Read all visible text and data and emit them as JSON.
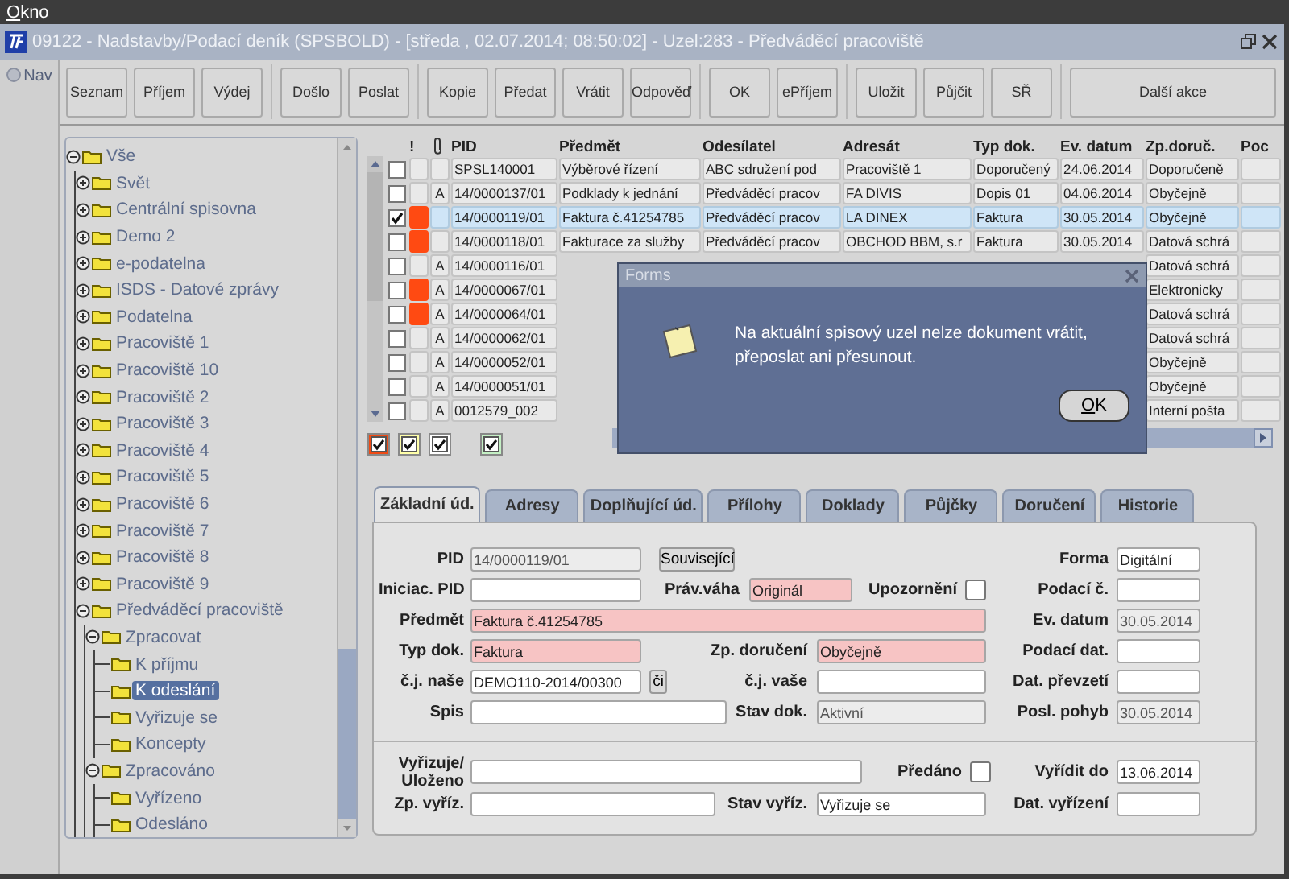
{
  "window": {
    "menu_title": "Okno",
    "title": "09122 - Nadstavby/Podací deník (SPSBOLD) - [středa , 02.07.2014; 08:50:02] - Uzel:283 - Předváděcí pracoviště"
  },
  "nav": {
    "label": "Nav"
  },
  "toolbar": {
    "groups": [
      {
        "buttons": [
          "Seznam",
          "Příjem",
          "Výdej"
        ]
      },
      {
        "buttons": [
          "Došlo",
          "Poslat"
        ]
      },
      {
        "buttons": [
          "Kopie",
          "Předat",
          "Vrátit",
          "Odpověď"
        ]
      },
      {
        "buttons": [
          "OK",
          "ePříjem"
        ]
      },
      {
        "buttons": [
          "Uložit",
          "Půjčit",
          "SŘ"
        ]
      },
      {
        "buttons": [
          "Další akce"
        ]
      }
    ]
  },
  "tree": [
    {
      "label": "Vše",
      "expanded": true,
      "selected": false,
      "children": [
        {
          "label": "Svět",
          "expanded": false,
          "selected": false
        },
        {
          "label": "Centrální spisovna",
          "expanded": false,
          "selected": false
        },
        {
          "label": "Demo 2",
          "expanded": false,
          "selected": false
        },
        {
          "label": "e-podatelna",
          "expanded": false,
          "selected": false
        },
        {
          "label": "ISDS - Datové zprávy",
          "expanded": false,
          "selected": false
        },
        {
          "label": "Podatelna",
          "expanded": false,
          "selected": false
        },
        {
          "label": "Pracoviště 1",
          "expanded": false,
          "selected": false
        },
        {
          "label": "Pracoviště 10",
          "expanded": false,
          "selected": false
        },
        {
          "label": "Pracoviště 2",
          "expanded": false,
          "selected": false
        },
        {
          "label": "Pracoviště 3",
          "expanded": false,
          "selected": false
        },
        {
          "label": "Pracoviště 4",
          "expanded": false,
          "selected": false
        },
        {
          "label": "Pracoviště 5",
          "expanded": false,
          "selected": false
        },
        {
          "label": "Pracoviště 6",
          "expanded": false,
          "selected": false
        },
        {
          "label": "Pracoviště 7",
          "expanded": false,
          "selected": false
        },
        {
          "label": "Pracoviště 8",
          "expanded": false,
          "selected": false
        },
        {
          "label": "Pracoviště 9",
          "expanded": false,
          "selected": false
        },
        {
          "label": "Předváděcí pracoviště",
          "expanded": true,
          "selected": false,
          "children": [
            {
              "label": "Zpracovat",
              "expanded": true,
              "selected": false,
              "children": [
                {
                  "label": "K příjmu",
                  "selected": false
                },
                {
                  "label": "K odeslání",
                  "selected": true
                },
                {
                  "label": "Vyřizuje se",
                  "selected": false
                },
                {
                  "label": "Koncepty",
                  "selected": false
                }
              ]
            },
            {
              "label": "Zpracováno",
              "expanded": true,
              "selected": false,
              "children": [
                {
                  "label": "Vyřízeno",
                  "selected": false
                },
                {
                  "label": "Odesláno",
                  "selected": false
                }
              ]
            }
          ]
        }
      ]
    }
  ],
  "table": {
    "columns": [
      "!",
      "PID",
      "Předmět",
      "Odesílatel",
      "Adresát",
      "Typ dok.",
      "Ev. datum",
      "Zp.doruč.",
      "Poc"
    ],
    "rows": [
      {
        "checked": false,
        "selected": false,
        "pid": "SPSL140001",
        "subject": "Výběrové řízení",
        "sender": "ABC sdružení pod",
        "recipient": "Pracoviště 1",
        "doc_type": "Doporučený",
        "date": "24.06.2014",
        "delivery": "Doporučeně"
      },
      {
        "checked": false,
        "selected": false,
        "mark": "A",
        "pid": "14/0000137/01",
        "subject": "Podklady k jednání",
        "sender": "Předváděcí pracov",
        "recipient": "FA DIVIS",
        "doc_type": "Dopis 01",
        "date": "04.06.2014",
        "delivery": "Obyčejně"
      },
      {
        "checked": true,
        "selected": true,
        "color": "#ff4a12",
        "pid": "14/0000119/01",
        "subject": "Faktura č.41254785",
        "sender": "Předváděcí pracov",
        "recipient": "LA DINEX",
        "doc_type": "Faktura",
        "date": "30.05.2014",
        "delivery": "Obyčejně"
      },
      {
        "checked": false,
        "selected": false,
        "color": "#ff4a12",
        "pid": "14/0000118/01",
        "subject": "Fakturace za služby",
        "sender": "Předváděcí pracov",
        "recipient": "OBCHOD BBM, s.r",
        "doc_type": "Faktura",
        "date": "30.05.2014",
        "delivery": "Datová schrá"
      },
      {
        "checked": false,
        "selected": false,
        "mark": "A",
        "pid": "14/0000116/01",
        "delivery": "Datová schrá"
      },
      {
        "checked": false,
        "selected": false,
        "color": "#ff4a12",
        "mark": "A",
        "pid": "14/0000067/01",
        "delivery": "Elektronicky"
      },
      {
        "checked": false,
        "selected": false,
        "color": "#ff4a12",
        "mark": "A",
        "pid": "14/0000064/01",
        "delivery": "Datová schrá"
      },
      {
        "checked": false,
        "selected": false,
        "mark": "A",
        "pid": "14/0000062/01",
        "delivery": "Datová schrá"
      },
      {
        "checked": false,
        "selected": false,
        "mark": "A",
        "pid": "14/0000052/01",
        "delivery": "Obyčejně"
      },
      {
        "checked": false,
        "selected": false,
        "mark": "A",
        "pid": "14/0000051/01",
        "delivery": "Obyčejně"
      },
      {
        "checked": false,
        "selected": false,
        "mark": "A",
        "pid": "0012579_002",
        "delivery": "Interní pošta"
      }
    ]
  },
  "legend": [
    {
      "color": "#f04a14",
      "checked": true
    },
    {
      "color": "#ffffa8",
      "checked": true
    },
    {
      "color": "#ffffff",
      "checked": true
    },
    {
      "color": "#c4f0c4",
      "checked": true
    }
  ],
  "dialog": {
    "title": "Forms",
    "message": "Na aktuální spisový uzel nelze dokument vrátit, přeposlat ani přesunout.",
    "button": "OK"
  },
  "tabs": [
    {
      "label": "Základní úd.",
      "selected": true
    },
    {
      "label": "Adresy",
      "selected": false
    },
    {
      "label": "Doplňující úd.",
      "selected": false
    },
    {
      "label": "Přílohy",
      "selected": false
    },
    {
      "label": "Doklady",
      "selected": false
    },
    {
      "label": "Půjčky",
      "selected": false
    },
    {
      "label": "Doručení",
      "selected": false
    },
    {
      "label": "Historie",
      "selected": false
    }
  ],
  "form": {
    "fields": [
      {
        "kind": "field",
        "label": "PID",
        "value": "14/0000119/01",
        "readonly": true,
        "required": false
      },
      {
        "kind": "button",
        "label": "Související"
      },
      {
        "kind": "field",
        "label": "Forma",
        "value": "Digitální",
        "readonly": false,
        "required": false
      },
      {
        "kind": "field",
        "label": "Iniciac. PID",
        "readonly": false,
        "required": false
      },
      {
        "kind": "field",
        "label": "Práv.váha",
        "value": "Originál",
        "readonly": false,
        "required": true
      },
      {
        "kind": "checkbox",
        "label": "Upozornění",
        "checked": false
      },
      {
        "kind": "field",
        "label": "Podací č.",
        "readonly": false,
        "required": false
      },
      {
        "kind": "field",
        "label": "Předmět",
        "value": "Faktura č.41254785",
        "readonly": false,
        "required": true
      },
      {
        "kind": "field",
        "label": "Ev. datum",
        "value": "30.05.2014",
        "readonly": true,
        "required": false
      },
      {
        "kind": "field",
        "label": "Typ dok.",
        "value": "Faktura",
        "readonly": false,
        "required": true
      },
      {
        "kind": "field",
        "label": "Zp. doručení",
        "value": "Obyčejně",
        "readonly": false,
        "required": true
      },
      {
        "kind": "field",
        "label": "Podací dat.",
        "readonly": false,
        "required": false
      },
      {
        "kind": "field",
        "label": "č.j. naše",
        "value": "DEMO110-2014/00300",
        "readonly": false,
        "required": false
      },
      {
        "kind": "button",
        "label": "či"
      },
      {
        "kind": "field",
        "label": "č.j. vaše",
        "readonly": false,
        "required": false
      },
      {
        "kind": "field",
        "label": "Dat. převzetí",
        "readonly": false,
        "required": false
      },
      {
        "kind": "field",
        "label": "Spis",
        "readonly": false,
        "required": false
      },
      {
        "kind": "field",
        "label": "Stav dok.",
        "value": "Aktivní",
        "readonly": true,
        "required": false
      },
      {
        "kind": "field",
        "label": "Posl. pohyb",
        "value": "30.05.2014",
        "readonly": true,
        "required": false
      },
      {
        "kind": "field",
        "label": "Vyřizuje/ Uloženo",
        "readonly": false,
        "required": false
      },
      {
        "kind": "checkbox",
        "label": "Předáno",
        "checked": false
      },
      {
        "kind": "field",
        "label": "Vyřídit do",
        "value": "13.06.2014",
        "readonly": false,
        "required": false
      },
      {
        "kind": "field",
        "label": "Zp. vyříz.",
        "readonly": false,
        "required": false
      },
      {
        "kind": "field",
        "label": "Stav vyříz.",
        "value": "Vyřizuje se",
        "readonly": false,
        "required": false
      },
      {
        "kind": "field",
        "label": "Dat. vyřízení",
        "readonly": false,
        "required": false
      }
    ]
  }
}
